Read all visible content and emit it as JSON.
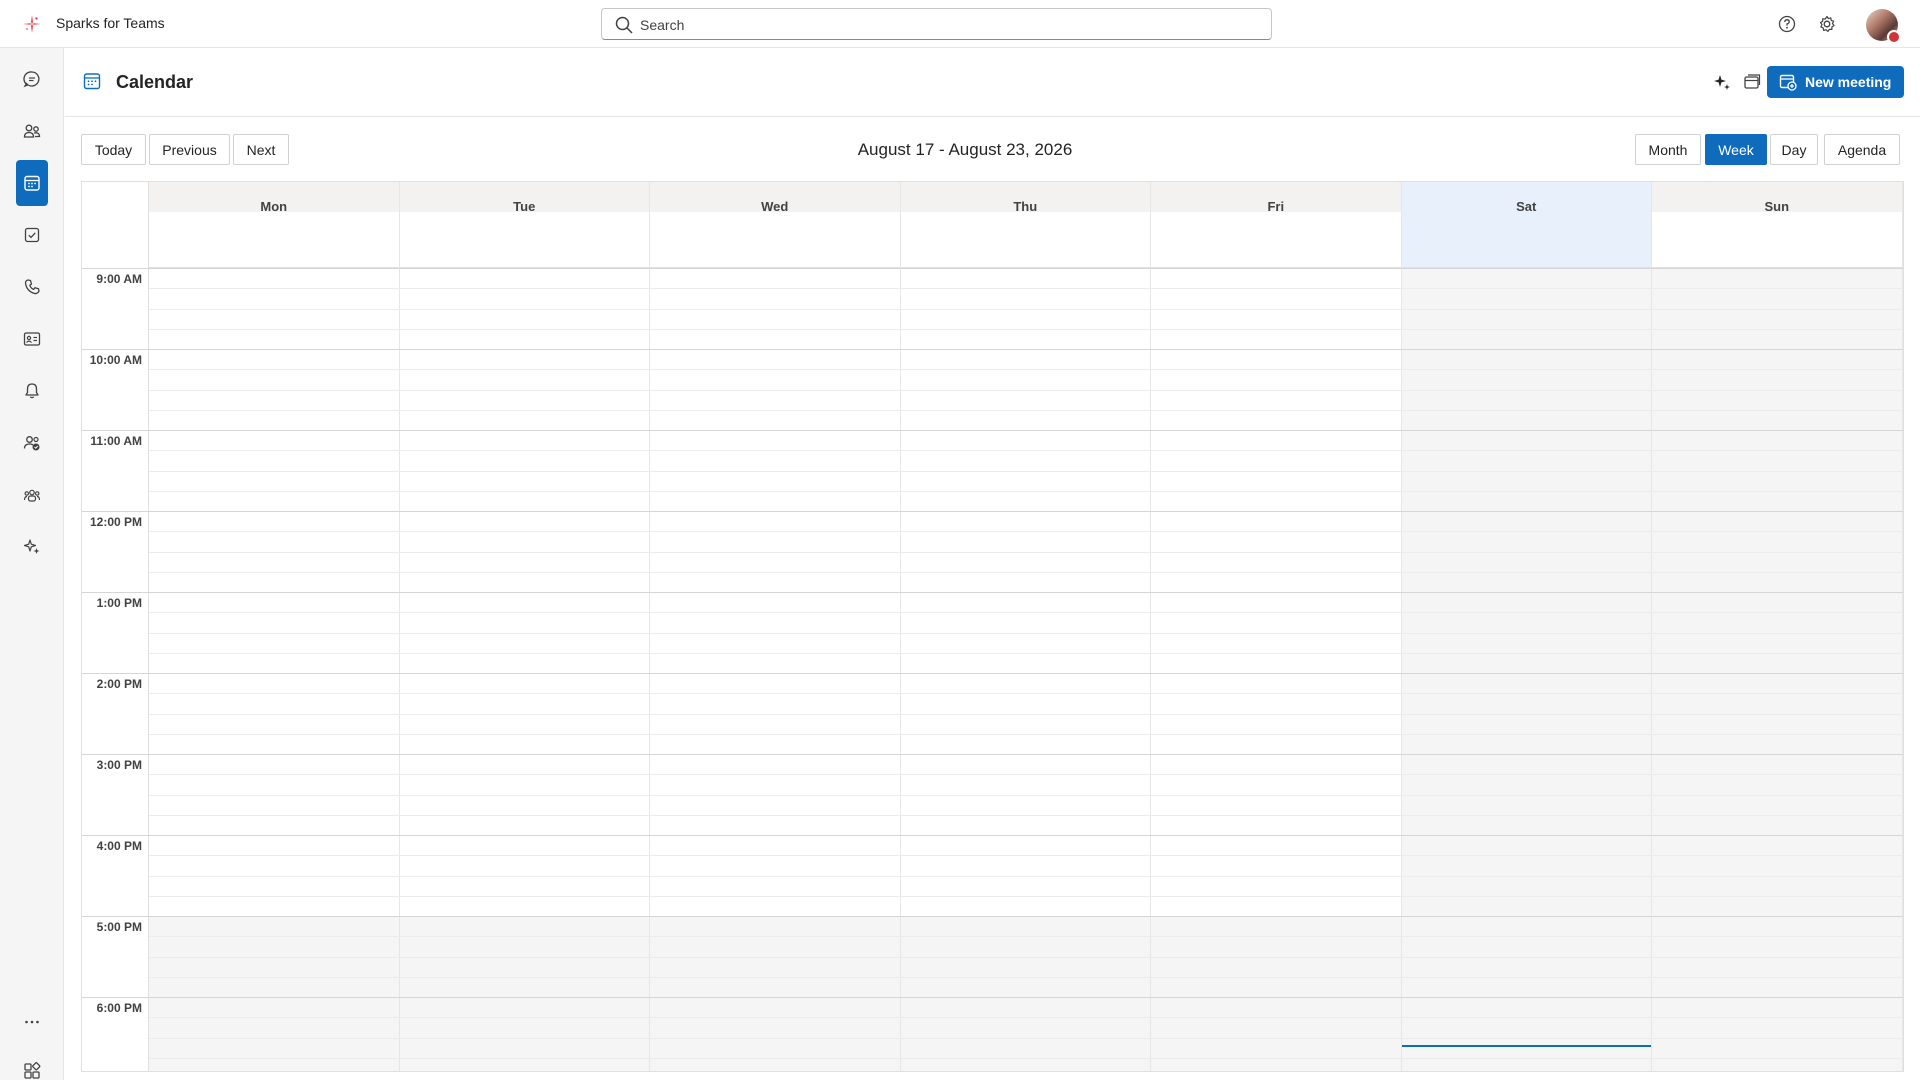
{
  "app": {
    "name": "Sparks for Teams"
  },
  "search": {
    "placeholder": "Search"
  },
  "topbar": {
    "icons": [
      "help-icon",
      "settings-icon"
    ],
    "avatar": "user-avatar",
    "presence_color": "#d13438"
  },
  "rail": {
    "items": [
      "chat-icon",
      "teams-icon",
      "calendar-icon",
      "tasks-icon",
      "calls-icon",
      "contacts-icon",
      "activity-icon",
      "people-icon",
      "community-icon",
      "copilot-icon",
      "more-icon",
      "apps-icon"
    ],
    "active": "calendar-icon"
  },
  "header": {
    "title": "Calendar",
    "new_meeting": "New meeting"
  },
  "toolbar": {
    "today": "Today",
    "previous": "Previous",
    "next": "Next",
    "date_range": "August 17 - August 23, 2026",
    "views": {
      "month": "Month",
      "week": "Week",
      "day": "Day",
      "agenda": "Agenda"
    },
    "selected_view": "Week"
  },
  "calendar": {
    "days": [
      "Mon",
      "Tue",
      "Wed",
      "Thu",
      "Fri",
      "Sat",
      "Sun"
    ],
    "highlighted_day": "Sat",
    "times": [
      "9:00 AM",
      "10:00 AM",
      "11:00 AM",
      "12:00 PM",
      "1:00 PM",
      "2:00 PM",
      "3:00 PM",
      "4:00 PM",
      "5:00 PM",
      "6:00 PM"
    ]
  },
  "colors": {
    "accent": "#0f6cbd",
    "highlight": "#e8f1fb",
    "offhours": "#f5f5f5"
  }
}
